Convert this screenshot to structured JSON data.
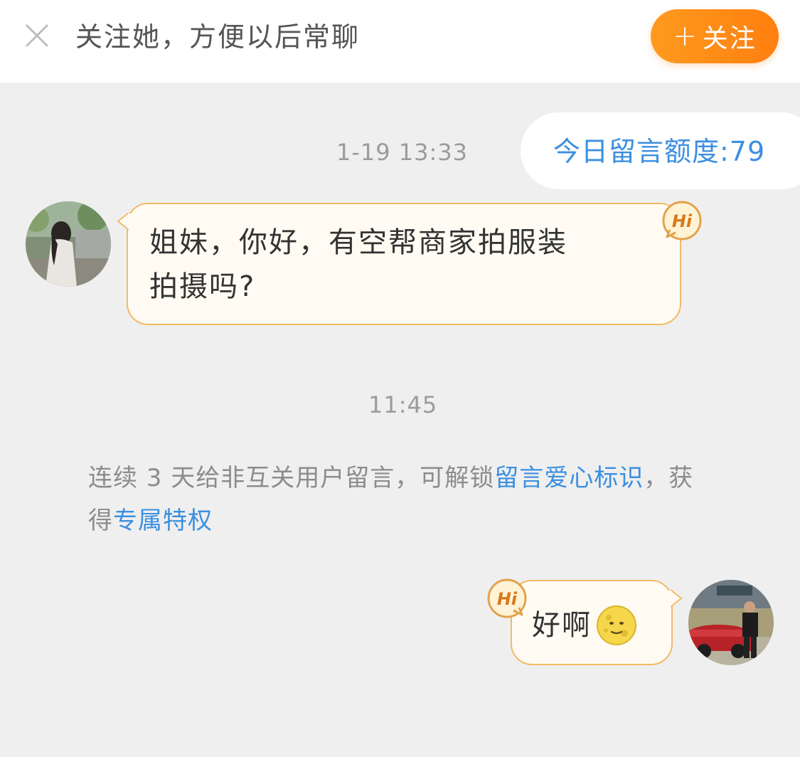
{
  "header": {
    "prompt_text": "关注她，方便以后常聊",
    "follow_button": "关注",
    "close_icon": "close-icon"
  },
  "quota": {
    "label": "今日留言额度:79"
  },
  "conversation": {
    "timestamp_1": "1-19 13:33",
    "incoming_message": {
      "text_line1": "姐妹，你好，有空帮商家拍服装",
      "text_line2": "拍摄吗?",
      "badge": "Hi"
    },
    "timestamp_2": "11:45",
    "notice": {
      "part1": "连续 3 天给非互关用户留言，可解锁",
      "link1": "留言爱心标识",
      "part2": "，获",
      "part3": "得",
      "link2": "专属特权"
    },
    "outgoing_message": {
      "text": "好啊",
      "badge": "Hi",
      "emoji": "moon-face-emoji"
    }
  },
  "colors": {
    "accent_orange": "#ff8c1a",
    "link_blue": "#3b8fe0",
    "bubble_border": "#f4b968",
    "bubble_fill": "#fffbf2",
    "background": "#efefef"
  }
}
